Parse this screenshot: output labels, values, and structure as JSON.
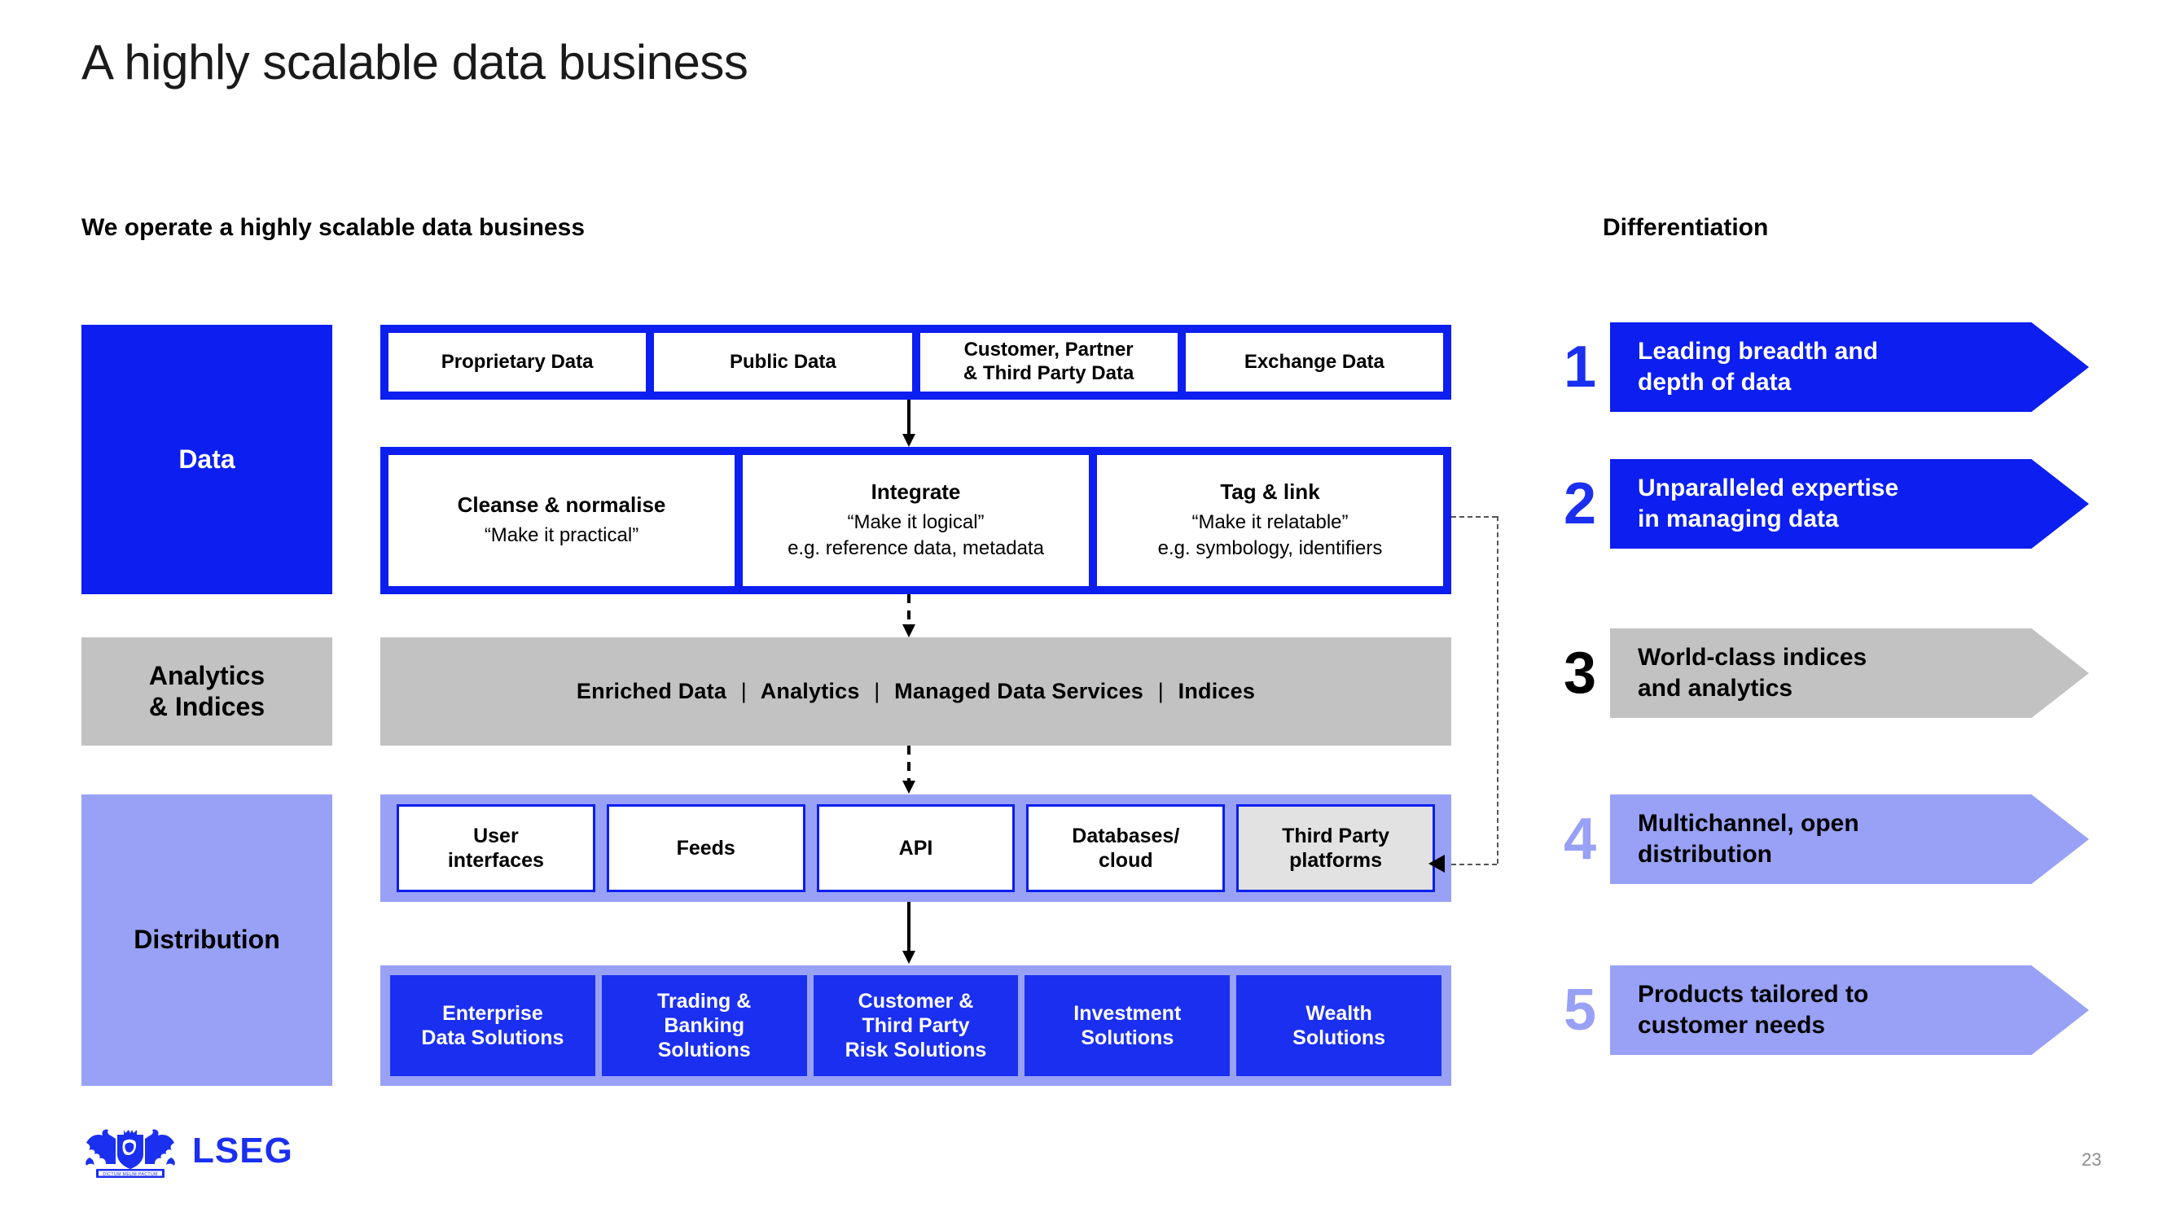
{
  "slide": {
    "title": "A highly scalable data business",
    "page_number": "23"
  },
  "left": {
    "subheading": "We operate a highly scalable data business",
    "layers": [
      {
        "id": "data",
        "label": "Data",
        "color": "#0c1ef0",
        "text_color": "#ffffff"
      },
      {
        "id": "analytics",
        "label": "Analytics\n& Indices",
        "color": "#c2c2c2",
        "text_color": "#000000"
      },
      {
        "id": "distribution",
        "label": "Distribution",
        "color": "#98a1f6",
        "text_color": "#000000"
      }
    ],
    "layer_labels": {
      "data": "Data",
      "analytics_line1": "Analytics",
      "analytics_line2": "& Indices",
      "distribution": "Distribution"
    },
    "data_sources": [
      {
        "line1": "Proprietary Data",
        "line2": ""
      },
      {
        "line1": "Public Data",
        "line2": ""
      },
      {
        "line1": "Customer, Partner",
        "line2": "& Third Party Data"
      },
      {
        "line1": "Exchange Data",
        "line2": ""
      }
    ],
    "processing": [
      {
        "title": "Cleanse & normalise",
        "sub1": "“Make it practical”",
        "sub2": ""
      },
      {
        "title": "Integrate",
        "sub1": "“Make it logical”",
        "sub2": "e.g. reference data, metadata"
      },
      {
        "title": "Tag & link",
        "sub1": "“Make it relatable”",
        "sub2": "e.g. symbology, identifiers"
      }
    ],
    "analytics_items": [
      "Enriched Data",
      "Analytics",
      "Managed Data Services",
      "Indices"
    ],
    "analytics_separator": "|",
    "channels": [
      {
        "line1": "User",
        "line2": "interfaces",
        "shaded": false
      },
      {
        "line1": "Feeds",
        "line2": "",
        "shaded": false
      },
      {
        "line1": "API",
        "line2": "",
        "shaded": false
      },
      {
        "line1": "Databases/",
        "line2": "cloud",
        "shaded": false
      },
      {
        "line1": "Third Party",
        "line2": "platforms",
        "shaded": true
      }
    ],
    "solutions": [
      {
        "line1": "Enterprise",
        "line2": "Data Solutions",
        "line3": ""
      },
      {
        "line1": "Trading &",
        "line2": "Banking",
        "line3": "Solutions"
      },
      {
        "line1": "Customer &",
        "line2": "Third Party",
        "line3": "Risk Solutions"
      },
      {
        "line1": "Investment",
        "line2": "Solutions",
        "line3": ""
      },
      {
        "line1": "Wealth",
        "line2": "Solutions",
        "line3": ""
      }
    ]
  },
  "right": {
    "subheading": "Differentiation",
    "items": [
      {
        "number": "1",
        "line1": "Leading breadth and",
        "line2": "depth of data",
        "fill": "#0c1ef0",
        "text_color": "#ffffff",
        "number_color": "#1b2ff0"
      },
      {
        "number": "2",
        "line1": "Unparalleled expertise",
        "line2": "in managing data",
        "fill": "#0c1ef0",
        "text_color": "#ffffff",
        "number_color": "#1b2ff0"
      },
      {
        "number": "3",
        "line1": "World-class indices",
        "line2": "and analytics",
        "fill": "#c2c2c2",
        "text_color": "#000000",
        "number_color": "#000000"
      },
      {
        "number": "4",
        "line1": "Multichannel, open",
        "line2": "distribution",
        "fill": "#98a1f6",
        "text_color": "#000000",
        "number_color": "#98a1f6"
      },
      {
        "number": "5",
        "line1": "Products tailored to",
        "line2": "customer needs",
        "fill": "#98a1f6",
        "text_color": "#000000",
        "number_color": "#98a1f6"
      }
    ]
  },
  "logo": {
    "text": "LSEG",
    "crest_motto": "DICTUM MEUM PACTUM",
    "color": "#1b2ff0"
  },
  "theme": {
    "blue": "#0c1ef0",
    "gray": "#c2c2c2",
    "periwinkle": "#98a1f6",
    "solution_blue": "#1b2ff0",
    "shaded_cell": "#e2e2e2"
  }
}
